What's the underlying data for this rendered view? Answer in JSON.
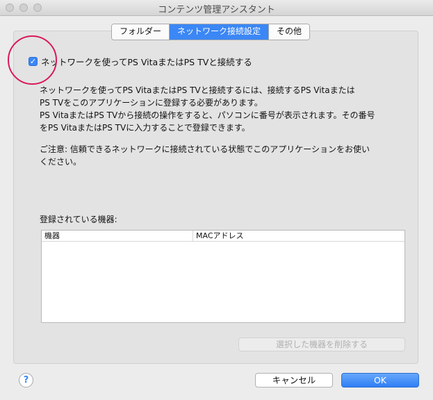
{
  "window": {
    "title": "コンテンツ管理アシスタント"
  },
  "tabs": [
    {
      "label": "フォルダー",
      "active": false
    },
    {
      "label": "ネットワーク接続設定",
      "active": true
    },
    {
      "label": "その他",
      "active": false
    }
  ],
  "network": {
    "checkbox_label": "ネットワークを使ってPS VitaまたはPS TVと接続する",
    "checked": true,
    "description": [
      "ネットワークを使ってPS VitaまたはPS TVと接続するには、接続するPS Vitaまたは",
      "PS TVをこのアプリケーションに登録する必要があります。",
      "PS VitaまたはPS TVから接続の操作をすると、パソコンに番号が表示されます。その番号",
      "をPS VitaまたはPS TVに入力することで登録できます。"
    ],
    "note": [
      "ご注意: 信頼できるネットワークに接続されている状態でこのアプリケーションをお使い",
      "ください。"
    ]
  },
  "registered": {
    "label": "登録されている機器:",
    "columns": [
      "機器",
      "MACアドレス"
    ],
    "rows": [],
    "delete_button": "選択した機器を削除する"
  },
  "footer": {
    "help": "?",
    "cancel": "キャンセル",
    "ok": "OK"
  },
  "colors": {
    "accent": "#3b87f5",
    "annotation": "#d8195a"
  }
}
